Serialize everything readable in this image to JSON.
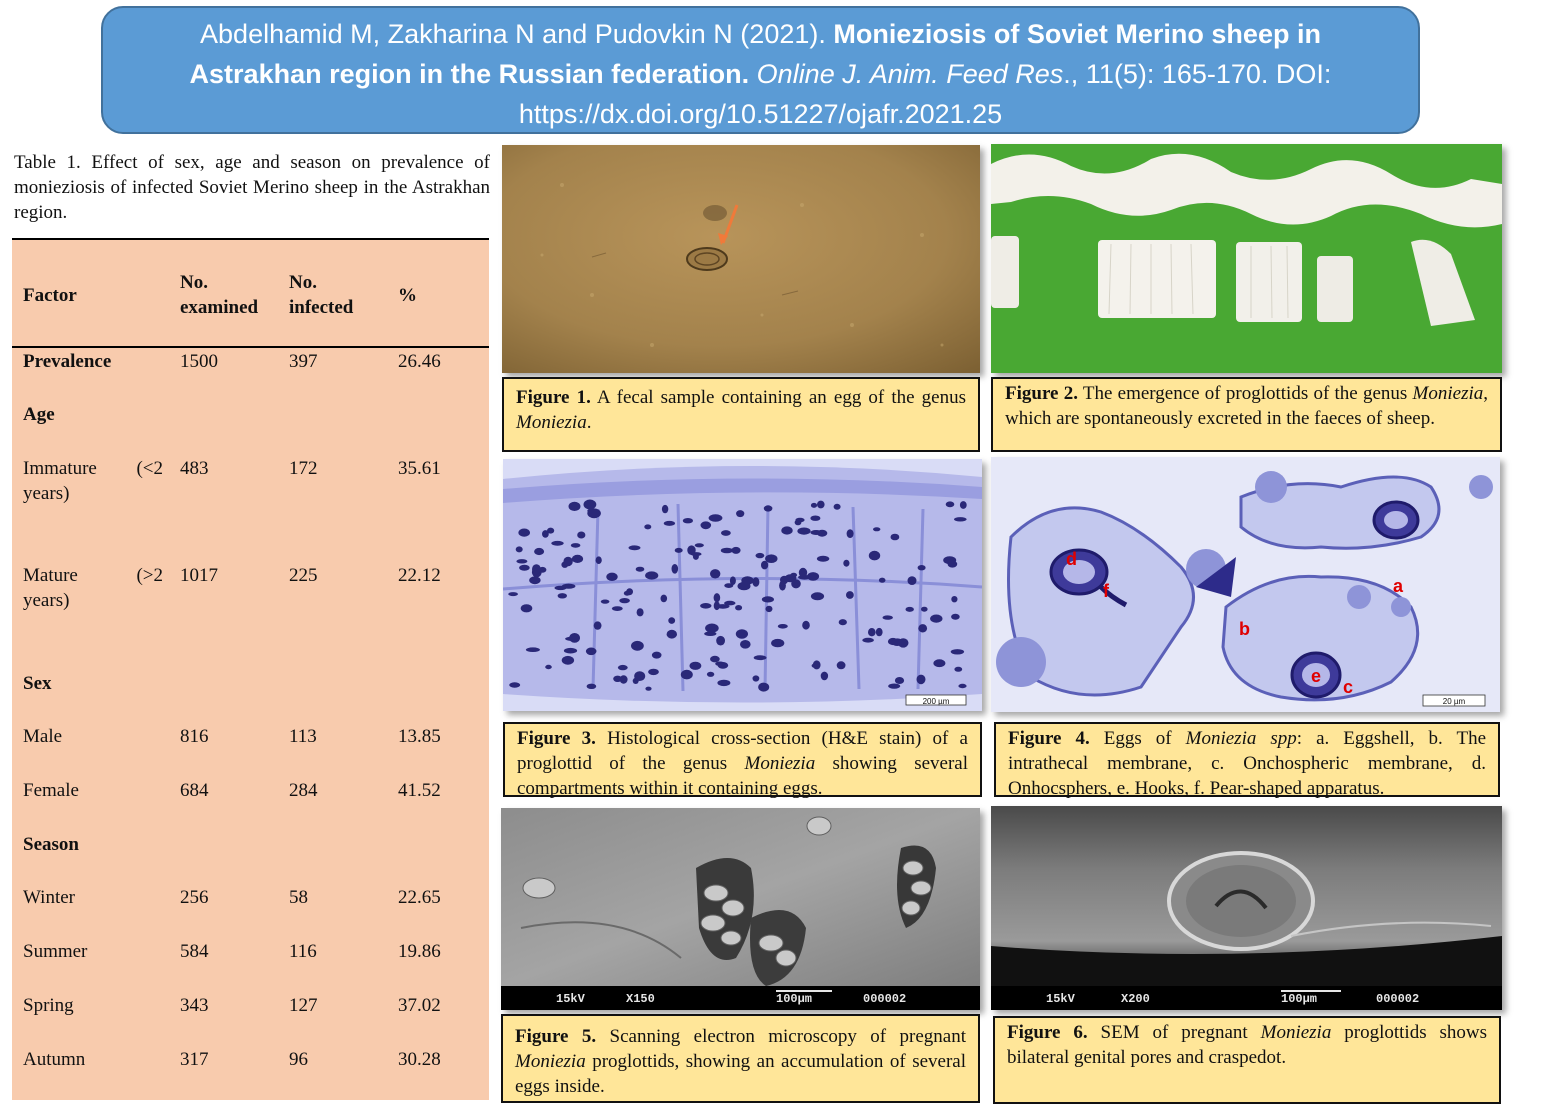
{
  "banner": {
    "authors": "Abdelhamid M, Zakharina N and Pudovkin N (2021).",
    "title": "Monieziosis of Soviet Merino sheep in Astrakhan region in the Russian federation.",
    "journal": "Online J. Anim. Feed Res",
    "volume": "., 11(5): 165-170. DOI: https://dx.doi.org/10.51227/ojafr.2021.25"
  },
  "table": {
    "caption": "Table 1. Effect of sex, age and season on prevalence of monieziosis of infected Soviet Merino sheep in the Astrakhan region.",
    "headers": [
      "Factor",
      "No. examined",
      "No. infected",
      "%"
    ],
    "rows": [
      {
        "factor": "Prevalence",
        "examined": "1500",
        "infected": "397",
        "pct": "26.46"
      },
      {
        "factor": "Age"
      },
      {
        "factor_a": "Immature",
        "factor_b": "(<2",
        "factor_c": "years)",
        "examined": "483",
        "infected": "172",
        "pct": "35.61"
      },
      {
        "factor_a": "Mature",
        "factor_b": "(>2",
        "factor_c": "years)",
        "examined": "1017",
        "infected": "225",
        "pct": "22.12"
      },
      {
        "factor": "Sex"
      },
      {
        "factor": "Male",
        "examined": "816",
        "infected": "113",
        "pct": "13.85"
      },
      {
        "factor": "Female",
        "examined": "684",
        "infected": "284",
        "pct": "41.52"
      },
      {
        "factor": "Season"
      },
      {
        "factor": "Winter",
        "examined": "256",
        "infected": "58",
        "pct": "22.65"
      },
      {
        "factor": "Summer",
        "examined": "584",
        "infected": "116",
        "pct": "19.86"
      },
      {
        "factor": "Spring",
        "examined": "343",
        "infected": "127",
        "pct": "37.02"
      },
      {
        "factor": "Autumn",
        "examined": "317",
        "infected": "96",
        "pct": "30.28"
      }
    ]
  },
  "figures": {
    "f1": {
      "label": "Figure 1.",
      "text": " A fecal sample containing an egg of the genus ",
      "genus": "Moniezia",
      "tail": "."
    },
    "f2": {
      "label": "Figure 2.",
      "text": " The emergence of proglottids of the genus ",
      "genus": "Moniezia",
      "tail": ", which are spontaneously excreted in the faeces of sheep."
    },
    "f3": {
      "label": "Figure 3.",
      "text": " Histological cross-section (H&E stain) of a proglottid of the genus ",
      "genus": "Moniezia",
      "tail": " showing several compartments within it containing eggs.",
      "scale": "200 µm"
    },
    "f4": {
      "label": "Figure 4.",
      "text": " Eggs of ",
      "genus": "Moniezia spp",
      "tail": ": a. Eggshell, b. The intrathecal membrane, c. Onchospheric membrane, d. Onhocsphers, e. Hooks, f. Pear-shaped apparatus.",
      "scale": "20 µm",
      "marks": [
        "a",
        "b",
        "c",
        "d",
        "e",
        "f"
      ]
    },
    "f5": {
      "label": "Figure 5.",
      "text": " Scanning electron microscopy of pregnant ",
      "genus": "Moniezia",
      "tail": " proglottids, showing an accumulation of several eggs inside.",
      "sem": [
        "15kV",
        "X150",
        "100µm",
        "000002"
      ]
    },
    "f6": {
      "label": "Figure 6.",
      "text": " SEM of pregnant ",
      "genus": "Moniezia",
      "tail": " proglottids shows bilateral genital pores and craspedot.",
      "sem": [
        "15kV",
        "X200",
        "100µm",
        "000002"
      ]
    }
  },
  "colors": {
    "banner": "#5b9bd5",
    "table_bg": "#f8cbad",
    "caption_bg": "#ffe699",
    "mark_red": "#e00000"
  }
}
